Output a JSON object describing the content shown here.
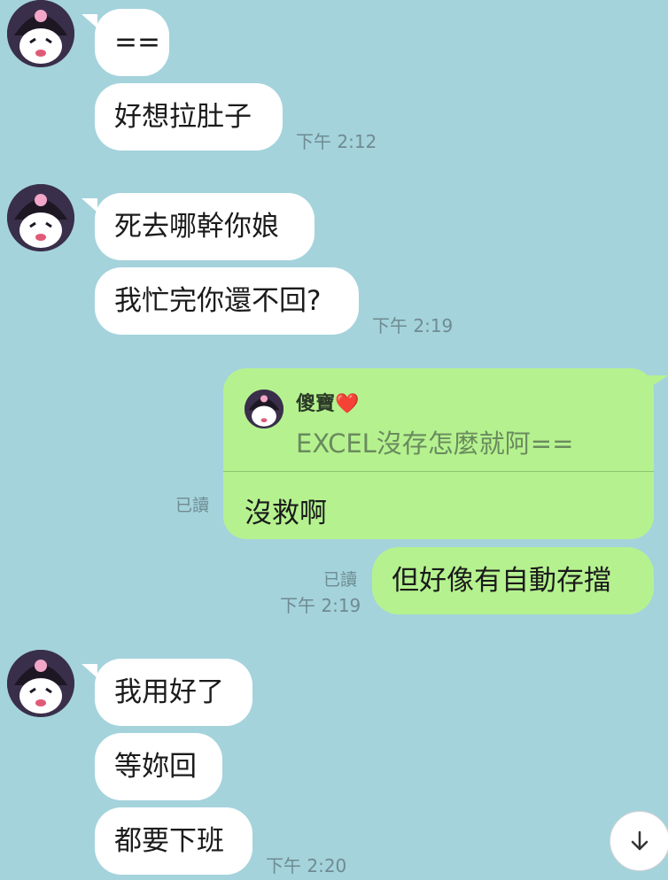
{
  "messages": {
    "group1": {
      "m1": "==",
      "m2": "好想拉肚子",
      "time": "下午 2:12"
    },
    "group2": {
      "m1": "死去哪幹你娘",
      "m2": "我忙完你還不回?",
      "time": "下午 2:19"
    },
    "reply": {
      "quoted_name": "傻寶",
      "quoted_name_emoji": "❤️",
      "quoted_text": "EXCEL沒存怎麼就阿==",
      "text": "沒救啊",
      "read": "已讀"
    },
    "outgoing2": {
      "text": "但好像有自動存擋",
      "read": "已讀",
      "time": "下午 2:19"
    },
    "group3": {
      "m1": "我用好了",
      "m2": "等妳回",
      "m3": "都要下班",
      "time": "下午 2:20"
    }
  },
  "colors": {
    "background": "#a4d3dc",
    "incoming_bubble": "#ffffff",
    "outgoing_bubble": "#b5f28f"
  },
  "icons": {
    "avatar": "kuromi-avatar-icon",
    "scroll_down": "arrow-down-icon"
  }
}
